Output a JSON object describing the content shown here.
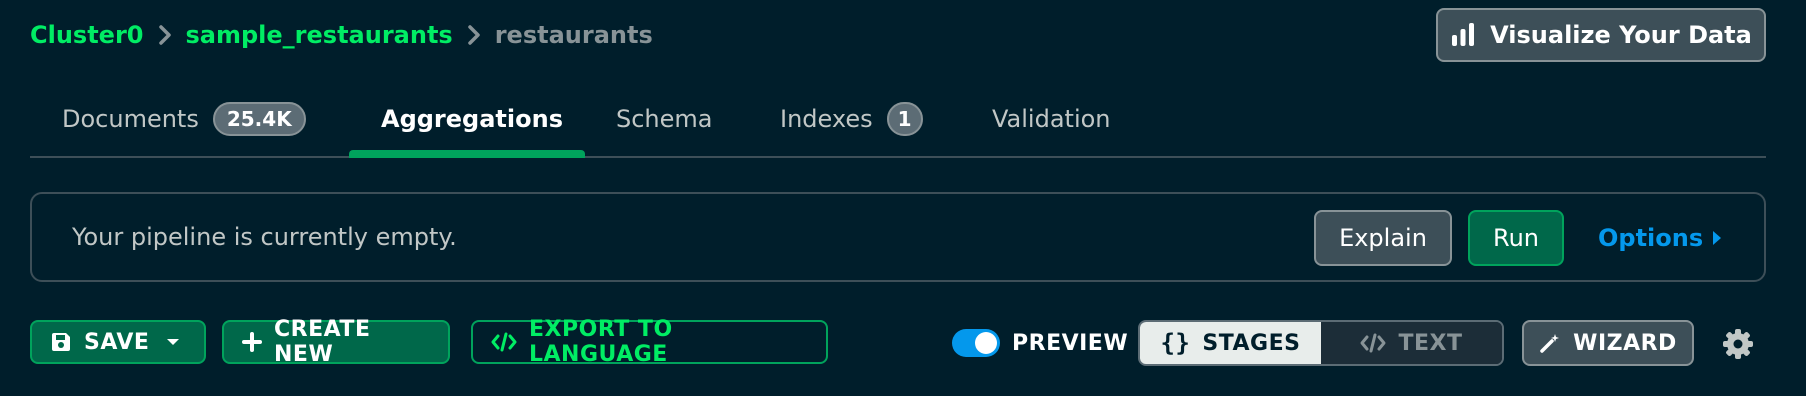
{
  "breadcrumb": {
    "cluster": "Cluster0",
    "database": "sample_restaurants",
    "collection": "restaurants"
  },
  "header": {
    "visualize_label": "Visualize Your Data"
  },
  "tabs": [
    {
      "label": "Documents",
      "badge": "25.4K"
    },
    {
      "label": "Aggregations"
    },
    {
      "label": "Schema"
    },
    {
      "label": "Indexes",
      "badge": "1"
    },
    {
      "label": "Validation"
    }
  ],
  "active_tab": "Aggregations",
  "pipeline": {
    "empty_message": "Your pipeline is currently empty.",
    "explain_label": "Explain",
    "run_label": "Run",
    "options_label": "Options"
  },
  "toolbar": {
    "save_label": "SAVE",
    "create_new_label": "CREATE NEW",
    "export_label": "EXPORT TO LANGUAGE",
    "preview_label": "PREVIEW",
    "preview_enabled": true,
    "stages_label": "STAGES",
    "text_label": "TEXT",
    "view_mode": "STAGES",
    "wizard_label": "WIZARD"
  },
  "icons": {
    "chevron": "chevron-right-icon",
    "chart": "bar-chart-icon",
    "save": "floppy-disk-icon",
    "caret": "caret-down-icon",
    "plus": "plus-icon",
    "code": "code-icon",
    "braces": "curly-braces-icon",
    "wand": "magic-wand-icon",
    "gear": "gear-icon"
  },
  "colors": {
    "background": "#001e2b",
    "accent_green": "#00ed64",
    "link_blue": "#0498ec"
  }
}
